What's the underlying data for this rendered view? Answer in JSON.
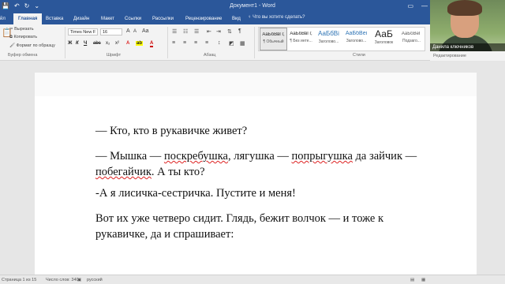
{
  "titlebar": {
    "title": "Документ1 - Word",
    "qat": {
      "save": "💾",
      "undo": "↶",
      "redo": "↻",
      "more": "⌄"
    },
    "ribbon_display": "▭",
    "minimize": "—"
  },
  "tabs": {
    "file": "йл",
    "items": [
      "Главная",
      "Вставка",
      "Дизайн",
      "Макет",
      "Ссылки",
      "Рассылки",
      "Рецензирование",
      "Вид"
    ],
    "tellme": "Что вы хотите сделать?"
  },
  "clipboard": {
    "cut": "Вырезать",
    "copy": "Копировать",
    "format_painter": "Формат по образцу",
    "label": "Буфер обмена"
  },
  "font": {
    "name": "Times New F",
    "size": "16",
    "grow": "A",
    "shrink": "A",
    "case": "Aa",
    "bold": "Ж",
    "italic": "К",
    "underline": "Ч",
    "strike": "abc",
    "subscript": "x₂",
    "superscript": "x²",
    "label": "Шрифт"
  },
  "paragraph": {
    "label": "Абзац",
    "pilcrow": "¶"
  },
  "styles": {
    "label": "Стили",
    "items": [
      {
        "preview": "АаБбВвГг,",
        "name": "¶ Обычный"
      },
      {
        "preview": "АаБбВвГг,",
        "name": "¶ Без инте..."
      },
      {
        "preview": "АаБбВі",
        "name": "Заголово..."
      },
      {
        "preview": "АаБбВеі",
        "name": "Заголово..."
      },
      {
        "preview": "АаБ",
        "name": "Заголовок"
      },
      {
        "preview": "АаБбВеГ",
        "name": "Подзаго..."
      }
    ]
  },
  "editing": {
    "label": "Редактирование"
  },
  "webcam": {
    "name": "Данила ключников"
  },
  "document": {
    "paragraphs": [
      {
        "pre": "— Кто, кто в рукавичке живет?"
      },
      {
        "pre": "— Мышка — ",
        "sq1": "поскребушка",
        "mid": ", лягушка — ",
        "sq2": "попрыгушка",
        "mid2": " да зайчик —",
        "line2_sq": "побегайчик",
        "line2": ". А ты кто?"
      },
      {
        "pre": "-А я лисичка-сестричка. Пустите и меня!"
      },
      {
        "pre": "Вот их уже четверо сидит. Глядь, бежит волчок — и тоже к рукавичке, да и спрашивает:"
      }
    ]
  },
  "statusbar": {
    "page": "Страница 1 из 15",
    "words": "Число слов: 340",
    "lang": "русский"
  }
}
